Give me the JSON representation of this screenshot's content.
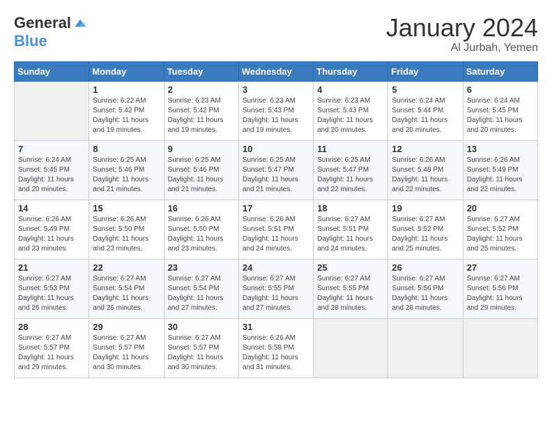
{
  "header": {
    "logo_general": "General",
    "logo_blue": "Blue",
    "month": "January 2024",
    "location": "Al Jurbah, Yemen"
  },
  "days_of_week": [
    "Sunday",
    "Monday",
    "Tuesday",
    "Wednesday",
    "Thursday",
    "Friday",
    "Saturday"
  ],
  "weeks": [
    [
      {
        "day": "",
        "empty": true
      },
      {
        "day": "1",
        "sunrise": "6:22 AM",
        "sunset": "5:42 PM",
        "daylight": "11 hours and 19 minutes."
      },
      {
        "day": "2",
        "sunrise": "6:23 AM",
        "sunset": "5:42 PM",
        "daylight": "11 hours and 19 minutes."
      },
      {
        "day": "3",
        "sunrise": "6:23 AM",
        "sunset": "5:43 PM",
        "daylight": "11 hours and 19 minutes."
      },
      {
        "day": "4",
        "sunrise": "6:23 AM",
        "sunset": "5:43 PM",
        "daylight": "11 hours and 20 minutes."
      },
      {
        "day": "5",
        "sunrise": "6:24 AM",
        "sunset": "5:44 PM",
        "daylight": "11 hours and 20 minutes."
      },
      {
        "day": "6",
        "sunrise": "6:24 AM",
        "sunset": "5:45 PM",
        "daylight": "11 hours and 20 minutes."
      }
    ],
    [
      {
        "day": "7",
        "sunrise": "6:24 AM",
        "sunset": "5:45 PM",
        "daylight": "11 hours and 20 minutes."
      },
      {
        "day": "8",
        "sunrise": "6:25 AM",
        "sunset": "5:46 PM",
        "daylight": "11 hours and 21 minutes."
      },
      {
        "day": "9",
        "sunrise": "6:25 AM",
        "sunset": "5:46 PM",
        "daylight": "11 hours and 21 minutes."
      },
      {
        "day": "10",
        "sunrise": "6:25 AM",
        "sunset": "5:47 PM",
        "daylight": "11 hours and 21 minutes."
      },
      {
        "day": "11",
        "sunrise": "6:25 AM",
        "sunset": "5:47 PM",
        "daylight": "11 hours and 22 minutes."
      },
      {
        "day": "12",
        "sunrise": "6:26 AM",
        "sunset": "5:48 PM",
        "daylight": "11 hours and 22 minutes."
      },
      {
        "day": "13",
        "sunrise": "6:26 AM",
        "sunset": "5:49 PM",
        "daylight": "11 hours and 22 minutes."
      }
    ],
    [
      {
        "day": "14",
        "sunrise": "6:26 AM",
        "sunset": "5:49 PM",
        "daylight": "11 hours and 23 minutes."
      },
      {
        "day": "15",
        "sunrise": "6:26 AM",
        "sunset": "5:50 PM",
        "daylight": "11 hours and 23 minutes."
      },
      {
        "day": "16",
        "sunrise": "6:26 AM",
        "sunset": "5:50 PM",
        "daylight": "11 hours and 23 minutes."
      },
      {
        "day": "17",
        "sunrise": "6:26 AM",
        "sunset": "5:51 PM",
        "daylight": "11 hours and 24 minutes."
      },
      {
        "day": "18",
        "sunrise": "6:27 AM",
        "sunset": "5:51 PM",
        "daylight": "11 hours and 24 minutes."
      },
      {
        "day": "19",
        "sunrise": "6:27 AM",
        "sunset": "5:52 PM",
        "daylight": "11 hours and 25 minutes."
      },
      {
        "day": "20",
        "sunrise": "6:27 AM",
        "sunset": "5:52 PM",
        "daylight": "11 hours and 25 minutes."
      }
    ],
    [
      {
        "day": "21",
        "sunrise": "6:27 AM",
        "sunset": "5:53 PM",
        "daylight": "11 hours and 26 minutes."
      },
      {
        "day": "22",
        "sunrise": "6:27 AM",
        "sunset": "5:54 PM",
        "daylight": "11 hours and 26 minutes."
      },
      {
        "day": "23",
        "sunrise": "6:27 AM",
        "sunset": "5:54 PM",
        "daylight": "11 hours and 27 minutes."
      },
      {
        "day": "24",
        "sunrise": "6:27 AM",
        "sunset": "5:55 PM",
        "daylight": "11 hours and 27 minutes."
      },
      {
        "day": "25",
        "sunrise": "6:27 AM",
        "sunset": "5:55 PM",
        "daylight": "11 hours and 28 minutes."
      },
      {
        "day": "26",
        "sunrise": "6:27 AM",
        "sunset": "5:56 PM",
        "daylight": "11 hours and 28 minutes."
      },
      {
        "day": "27",
        "sunrise": "6:27 AM",
        "sunset": "5:56 PM",
        "daylight": "11 hours and 29 minutes."
      }
    ],
    [
      {
        "day": "28",
        "sunrise": "6:27 AM",
        "sunset": "5:57 PM",
        "daylight": "11 hours and 29 minutes."
      },
      {
        "day": "29",
        "sunrise": "6:27 AM",
        "sunset": "5:57 PM",
        "daylight": "11 hours and 30 minutes."
      },
      {
        "day": "30",
        "sunrise": "6:27 AM",
        "sunset": "5:57 PM",
        "daylight": "11 hours and 30 minutes."
      },
      {
        "day": "31",
        "sunrise": "6:26 AM",
        "sunset": "5:58 PM",
        "daylight": "11 hours and 31 minutes."
      },
      {
        "day": "",
        "empty": true
      },
      {
        "day": "",
        "empty": true
      },
      {
        "day": "",
        "empty": true
      }
    ]
  ],
  "labels": {
    "sunrise": "Sunrise:",
    "sunset": "Sunset:",
    "daylight": "Daylight:"
  }
}
